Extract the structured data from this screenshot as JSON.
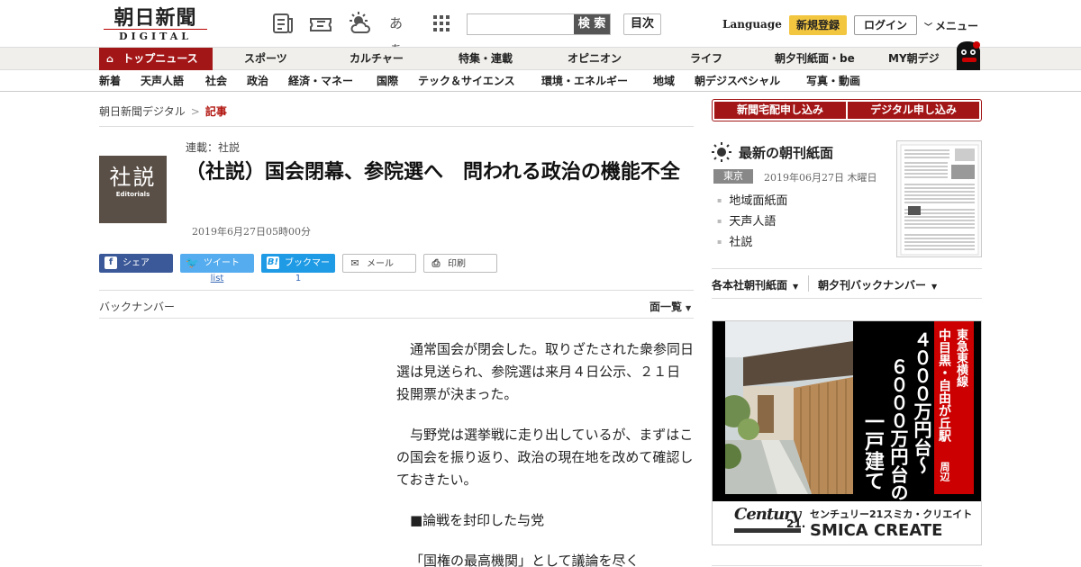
{
  "header": {
    "logo_jp": "朝日新聞",
    "logo_en": "DIGITAL",
    "icons": [
      "newspaper-icon",
      "coupon-icon",
      "weather-icon",
      "font-size-icon",
      "apps-grid-icon"
    ],
    "font_size_label": "あぁ",
    "search_placeholder": "",
    "search_button": "検 索",
    "mokuji": "目次",
    "language": "Language",
    "register": "新規登録",
    "login": "ログイン",
    "menu": "メニュー"
  },
  "nav_main": {
    "active": "トップニュース",
    "items": [
      "スポーツ",
      "カルチャー",
      "特集・連載",
      "オピニオン",
      "ライフ",
      "朝夕刊紙面・be",
      "MY朝デジ"
    ]
  },
  "nav_sub": {
    "items": [
      "新着",
      "天声人語",
      "社会",
      "政治",
      "経済・マネー",
      "国際",
      "テック＆サイエンス",
      "環境・エネルギー",
      "地域",
      "朝デジスペシャル",
      "写真・動画"
    ]
  },
  "breadcrumb": {
    "home": "朝日新聞デジタル",
    "sep": ">",
    "current": "記事"
  },
  "article": {
    "thumb_big": "社説",
    "thumb_small": "Editorials",
    "series": "連載：社説",
    "title": "（社説）国会閉幕、参院選へ　問われる政治の機能不全",
    "date": "2019年6月27日05時00分",
    "share": {
      "facebook": "シェア",
      "twitter": "ツイート",
      "hatena": "ブックマーク",
      "hatena_mark": "B!",
      "mail": "メール",
      "print": "印刷",
      "twitter_count": "list",
      "hatena_count": "1"
    },
    "backnumber": "バックナンバー",
    "menlist": "面一覧",
    "paragraphs": [
      "通常国会が閉会した。取りざたされた衆参同日選は見送られ、参院選は来月４日公示、２１日投開票が決まった。",
      "与野党は選挙戦に走り出しているが、まずはこの国会を振り返り、政治の現在地を改めて確認しておきたい。",
      "■論戦を封印した与党",
      "「国権の最高機関」として議論を尽く"
    ]
  },
  "sidebar": {
    "subscribe_paper": "新聞宅配申し込み",
    "subscribe_digital": "デジタル申し込み",
    "latest_title": "最新の朝刊紙面",
    "region": "東京",
    "paper_date": "2019年06月27日 木曜日",
    "paper_links": [
      "地域面紙面",
      "天声人語",
      "社説"
    ],
    "links": [
      "各本社朝刊紙面",
      "朝夕刊バックナンバー"
    ]
  },
  "ad": {
    "line_label": "東急東横線",
    "station": "中目黒・自由が丘駅",
    "area": "周辺",
    "price1": "４０００万円台～",
    "price2": "６０００万円台の",
    "type": "一戸建て",
    "brand_logo": "Century",
    "brand_num": "21.",
    "company_jp": "センチュリー21スミカ・クリエイト",
    "company_en": "SMICA CREATE"
  },
  "colors": {
    "brand_red": "#a31617",
    "register_yellow": "#f3c63f",
    "facebook": "#3b5998",
    "twitter": "#55acee",
    "hatena": "#1f9be5"
  }
}
